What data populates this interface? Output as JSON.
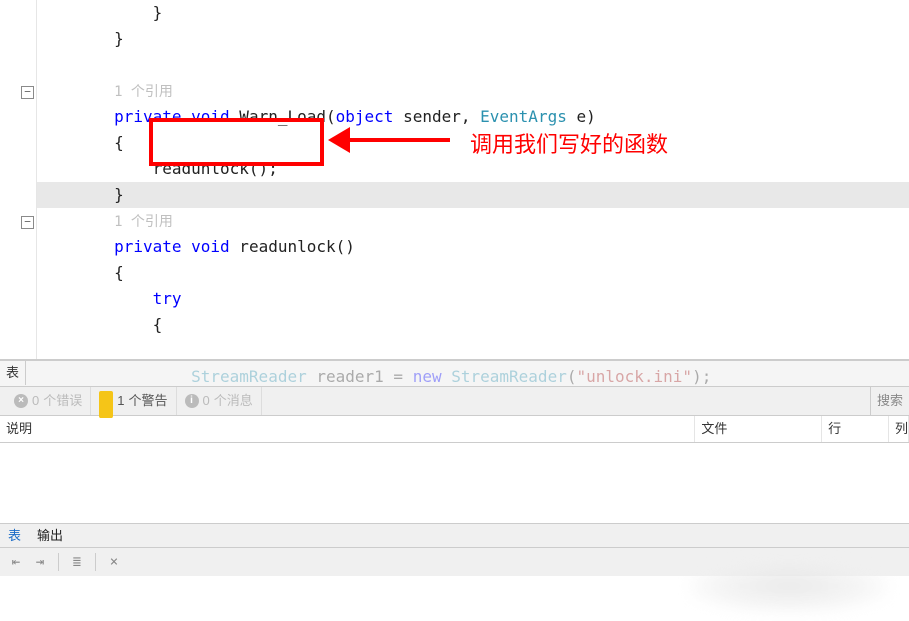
{
  "editor": {
    "lines": [
      {
        "indent": "            ",
        "segs": [
          {
            "t": "}"
          }
        ]
      },
      {
        "indent": "        ",
        "segs": [
          {
            "t": "}"
          }
        ]
      },
      {
        "indent": "",
        "segs": []
      },
      {
        "indent": "        ",
        "segs": [
          {
            "t": "1 个引用",
            "cls": "ref"
          }
        ]
      },
      {
        "indent": "        ",
        "segs": [
          {
            "t": "private",
            "cls": "kw"
          },
          {
            "t": " "
          },
          {
            "t": "void",
            "cls": "kw"
          },
          {
            "t": " Warn_Load("
          },
          {
            "t": "object",
            "cls": "kw"
          },
          {
            "t": " sender, "
          },
          {
            "t": "EventArgs",
            "cls": "type"
          },
          {
            "t": " e)"
          }
        ]
      },
      {
        "indent": "        ",
        "segs": [
          {
            "t": "{"
          }
        ]
      },
      {
        "indent": "            ",
        "segs": [
          {
            "t": "readunlock();"
          }
        ]
      },
      {
        "indent": "        ",
        "segs": [
          {
            "t": "}"
          }
        ],
        "hl": true
      },
      {
        "indent": "        ",
        "segs": [
          {
            "t": "1 个引用",
            "cls": "ref"
          }
        ]
      },
      {
        "indent": "        ",
        "segs": [
          {
            "t": "private",
            "cls": "kw"
          },
          {
            "t": " "
          },
          {
            "t": "void",
            "cls": "kw"
          },
          {
            "t": " readunlock()"
          }
        ]
      },
      {
        "indent": "        ",
        "segs": [
          {
            "t": "{"
          }
        ]
      },
      {
        "indent": "            ",
        "segs": [
          {
            "t": "try",
            "cls": "kw"
          }
        ]
      },
      {
        "indent": "            ",
        "segs": [
          {
            "t": "{"
          }
        ]
      },
      {
        "indent": "",
        "segs": []
      },
      {
        "indent": "                ",
        "segs": [
          {
            "t": "StreamReader",
            "cls": "type"
          },
          {
            "t": " reader1 = "
          },
          {
            "t": "new",
            "cls": "kw"
          },
          {
            "t": " "
          },
          {
            "t": "StreamReader",
            "cls": "type"
          },
          {
            "t": "("
          },
          {
            "t": "\"unlock.ini\"",
            "cls": "str"
          },
          {
            "t": ");"
          }
        ],
        "cut": true
      }
    ],
    "annotation": "调用我们写好的函数",
    "folds": [
      86,
      216
    ]
  },
  "errorPanel": {
    "tab": "表",
    "errors": {
      "count": "0",
      "label": "个错误"
    },
    "warnings": {
      "count": "1",
      "label": "个警告"
    },
    "messages": {
      "count": "0",
      "label": "个消息"
    },
    "search": "搜索",
    "columns": {
      "desc": "说明",
      "file": "文件",
      "line": "行",
      "col": "列"
    }
  },
  "bottomTabs": {
    "list": "表",
    "output": "输出"
  },
  "toolbarIcons": [
    "indent-left",
    "indent-right",
    "sep",
    "word-wrap",
    "sep",
    "clear"
  ]
}
